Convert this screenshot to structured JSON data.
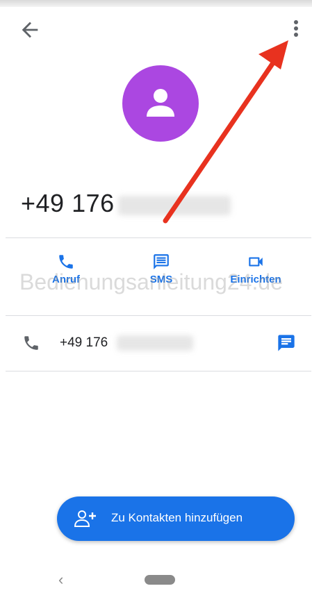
{
  "header": {
    "back_icon": "arrow-left-icon",
    "menu_icon": "more-vert-icon"
  },
  "contact": {
    "avatar_icon": "person-icon",
    "avatar_color": "#ab47e1",
    "number_visible": "+49 176"
  },
  "actions": [
    {
      "label": "Anruf",
      "icon": "phone-icon"
    },
    {
      "label": "SMS",
      "icon": "message-icon"
    },
    {
      "label": "Einrichten",
      "icon": "video-icon"
    }
  ],
  "watermark": "Bedienungsanleitung24.de",
  "phone_row": {
    "number_visible": "+49 176",
    "call_icon": "phone-icon",
    "message_icon": "message-icon"
  },
  "fab": {
    "label": "Zu Kontakten hinzufügen",
    "icon": "add-person-icon"
  },
  "nav": {
    "back_glyph": "‹"
  },
  "colors": {
    "accent": "#1a73e8",
    "annotation_arrow": "#e8321f"
  }
}
